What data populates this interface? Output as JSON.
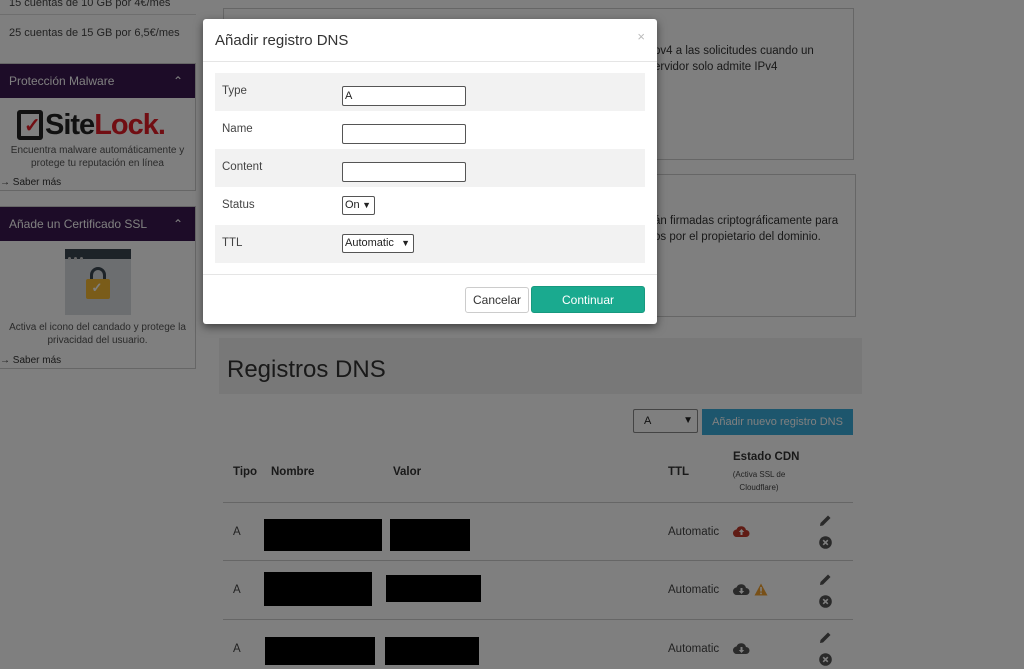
{
  "sidebar": {
    "promo_rows": [
      "15 cuentas de 10 GB por 4€/mes",
      "25 cuentas de 15 GB por 6,5€/mes"
    ],
    "malware_widget": {
      "title": "Protección Malware",
      "brand": "SiteLock",
      "description": "Encuentra malware automáticamente y protege tu reputación en línea",
      "link": "Saber más"
    },
    "ssl_widget": {
      "title": "Añade un Certificado SSL",
      "description": "Activa el icono del candado y protege la privacidad del usuario.",
      "link": "Saber más"
    }
  },
  "cards": [
    {
      "text_line1": "pv4 a las solicitudes cuando un",
      "text_line2": "ervidor solo admite IPv4"
    },
    {
      "text_line1": "án firmadas criptográficamente para",
      "text_line2": "os por el propietario del dominio."
    }
  ],
  "dns_section": {
    "title": "Registros DNS",
    "type_filter_value": "A",
    "add_button": "Añadir nuevo registro DNS",
    "columns": {
      "tipo": "Tipo",
      "nombre": "Nombre",
      "valor": "Valor",
      "ttl": "TTL",
      "cdn": "Estado CDN",
      "cdn_sub1": "(Activa SSL de",
      "cdn_sub2": "Cloudflare)"
    },
    "rows": [
      {
        "tipo": "A",
        "ttl": "Automatic",
        "cdn_icon": "cloud-upload-icon",
        "warning": false
      },
      {
        "tipo": "A",
        "ttl": "Automatic",
        "cdn_icon": "cloud-download-icon",
        "warning": true
      },
      {
        "tipo": "A",
        "ttl": "Automatic",
        "cdn_icon": "cloud-download-icon",
        "warning": false
      }
    ]
  },
  "modal": {
    "title": "Añadir registro DNS",
    "close_symbol": "×",
    "fields": {
      "type_label": "Type",
      "type_value": "A",
      "name_label": "Name",
      "name_value": "",
      "content_label": "Content",
      "content_value": "",
      "status_label": "Status",
      "status_value": "On",
      "ttl_label": "TTL",
      "ttl_value": "Automatic"
    },
    "cancel_label": "Cancelar",
    "continue_label": "Continuar"
  },
  "colors": {
    "widget_header": "#3a1950",
    "add_button": "#3aaddb",
    "continue_button": "#1aaa8f",
    "cdn_active": "#c0392b",
    "warning": "#f0a030"
  }
}
